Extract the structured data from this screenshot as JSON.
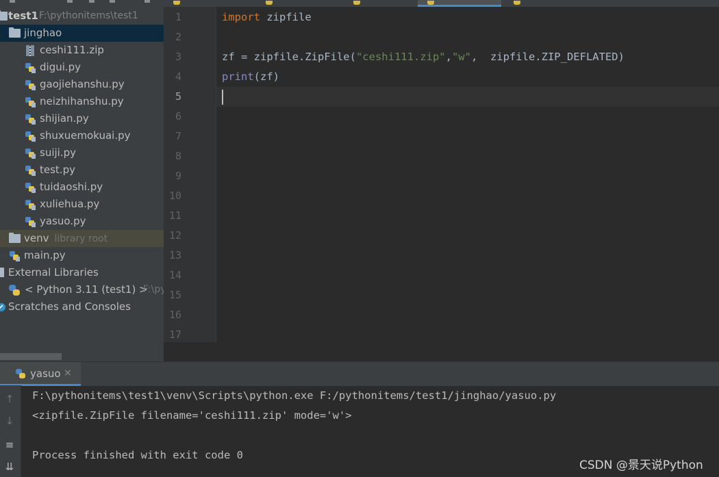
{
  "project": {
    "root_name": "test1",
    "root_path": "F:\\pythonitems\\test1",
    "folder": "jinghao",
    "files": [
      "ceshi111.zip",
      "digui.py",
      "gaojiehanshu.py",
      "neizhihanshu.py",
      "shijian.py",
      "shuxuemokuai.py",
      "suiji.py",
      "test.py",
      "tuidaoshi.py",
      "xuliehua.py",
      "yasuo.py"
    ],
    "venv_label": "venv",
    "venv_note": "library root",
    "main_file": "main.py",
    "external_libraries": "External Libraries",
    "python_sdk": "< Python 3.11 (test1) >",
    "python_sdk_path": "F:\\py",
    "scratches": "Scratches and Consoles"
  },
  "editor": {
    "line_numbers": [
      "1",
      "2",
      "3",
      "4",
      "5",
      "6",
      "7",
      "8",
      "9",
      "10",
      "11",
      "12",
      "13",
      "14",
      "15",
      "16",
      "17"
    ],
    "current_line": 5,
    "code": {
      "l1_kw": "import",
      "l1_rest": " zipfile",
      "l3_a": "zf = zipfile.ZipFile(",
      "l3_s1": "\"ceshi111.zip\"",
      "l3_b": ",",
      "l3_s2": "\"w\"",
      "l3_c": ",  zipfile.ZIP_DEFLATED)",
      "l4_builtin": "print",
      "l4_rest": "(zf)"
    }
  },
  "run": {
    "tab_label": "yasuo",
    "close_glyph": "×",
    "console": [
      "F:\\pythonitems\\test1\\venv\\Scripts\\python.exe F:/pythonitems/test1/jinghao/yasuo.py",
      "<zipfile.ZipFile filename='ceshi111.zip' mode='w'>",
      "",
      "Process finished with exit code 0"
    ],
    "side_icons": [
      "arrow-up-icon",
      "arrow-down-icon",
      "soft-wrap-icon",
      "scroll-to-end-icon"
    ]
  },
  "watermark": "CSDN @景天说Python",
  "colors": {
    "keyword": "#cc7832",
    "string": "#6a8759",
    "builtin": "#8888c6",
    "selection": "#0d293e",
    "accent": "#4a88c7"
  }
}
